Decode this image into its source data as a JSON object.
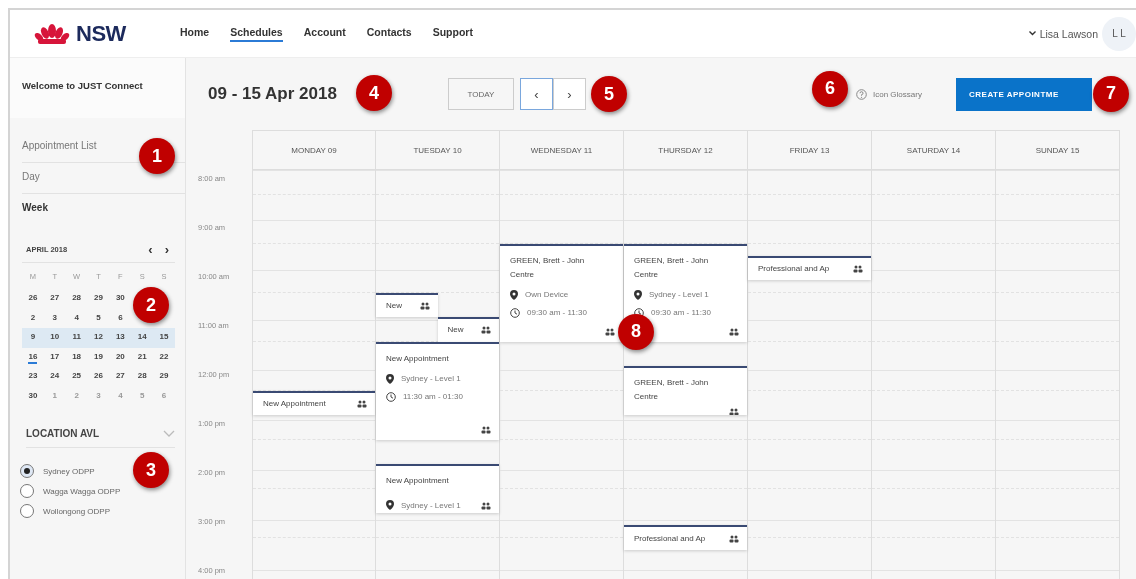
{
  "header": {
    "logo": "NSW",
    "nav": [
      {
        "label": "Home",
        "selected": false
      },
      {
        "label": "Schedules",
        "selected": true
      },
      {
        "label": "Account",
        "selected": false
      },
      {
        "label": "Contacts",
        "selected": false
      },
      {
        "label": "Support",
        "selected": false
      }
    ],
    "user": {
      "name": "Lisa Lawson",
      "initials": "L L"
    }
  },
  "sidebar": {
    "welcome": "Welcome to JUST Connect",
    "callout": "1",
    "views": [
      {
        "label": "Appointment List",
        "selected": false
      },
      {
        "label": "Day",
        "selected": false
      },
      {
        "label": "Week",
        "selected": true
      }
    ],
    "mini_calendar": {
      "month": "APRIL 2018",
      "prev": "‹",
      "next": "›",
      "callout": "2",
      "weekdays": [
        "M",
        "T",
        "W",
        "T",
        "F",
        "S",
        "S"
      ],
      "weeks": [
        {
          "selected": false,
          "days": [
            {
              "d": "26",
              "muted": false,
              "today": false
            },
            {
              "d": "27",
              "muted": false,
              "today": false
            },
            {
              "d": "28",
              "muted": false,
              "today": false
            },
            {
              "d": "29",
              "muted": false,
              "today": false
            },
            {
              "d": "30",
              "muted": false,
              "today": false
            }
          ]
        },
        {
          "selected": false,
          "days": [
            {
              "d": "2",
              "muted": false,
              "today": false
            },
            {
              "d": "3",
              "muted": false,
              "today": false
            },
            {
              "d": "4",
              "muted": false,
              "today": false
            },
            {
              "d": "5",
              "muted": false,
              "today": false
            },
            {
              "d": "6",
              "muted": false,
              "today": false
            }
          ]
        },
        {
          "selected": true,
          "days": [
            {
              "d": "9",
              "muted": false,
              "today": false
            },
            {
              "d": "10",
              "muted": false,
              "today": false
            },
            {
              "d": "11",
              "muted": false,
              "today": false
            },
            {
              "d": "12",
              "muted": false,
              "today": false
            },
            {
              "d": "13",
              "muted": false,
              "today": false
            },
            {
              "d": "14",
              "muted": false,
              "today": false
            },
            {
              "d": "15",
              "muted": false,
              "today": false
            }
          ]
        },
        {
          "selected": false,
          "days": [
            {
              "d": "16",
              "muted": false,
              "today": true
            },
            {
              "d": "17",
              "muted": false,
              "today": false
            },
            {
              "d": "18",
              "muted": false,
              "today": false
            },
            {
              "d": "19",
              "muted": false,
              "today": false
            },
            {
              "d": "20",
              "muted": false,
              "today": false
            },
            {
              "d": "21",
              "muted": false,
              "today": false
            },
            {
              "d": "22",
              "muted": false,
              "today": false
            }
          ]
        },
        {
          "selected": false,
          "days": [
            {
              "d": "23",
              "muted": false,
              "today": false
            },
            {
              "d": "24",
              "muted": false,
              "today": false
            },
            {
              "d": "25",
              "muted": false,
              "today": false
            },
            {
              "d": "26",
              "muted": false,
              "today": false
            },
            {
              "d": "27",
              "muted": false,
              "today": false
            },
            {
              "d": "28",
              "muted": false,
              "today": false
            },
            {
              "d": "29",
              "muted": false,
              "today": false
            }
          ]
        },
        {
          "selected": false,
          "days": [
            {
              "d": "30",
              "muted": false,
              "today": false
            },
            {
              "d": "1",
              "muted": true,
              "today": false
            },
            {
              "d": "2",
              "muted": true,
              "today": false
            },
            {
              "d": "3",
              "muted": true,
              "today": false
            },
            {
              "d": "4",
              "muted": true,
              "today": false
            },
            {
              "d": "5",
              "muted": true,
              "today": false
            },
            {
              "d": "6",
              "muted": true,
              "today": false
            }
          ]
        }
      ]
    },
    "location": {
      "title": "LOCATION AVL",
      "callout": "3",
      "options": [
        {
          "label": "Sydney ODPP",
          "selected": true
        },
        {
          "label": "Wagga Wagga ODPP",
          "selected": false
        },
        {
          "label": "Wollongong ODPP",
          "selected": false
        }
      ]
    }
  },
  "toolbar": {
    "title": "09 - 15 Apr 2018",
    "title_callout": "4",
    "today": "TODAY",
    "prev": "‹",
    "next": "›",
    "nav_callout": "5",
    "glossary": "Icon Glossary",
    "glossary_callout": "6",
    "create": "CREATE APPOINTME",
    "create_callout": "7"
  },
  "calendar": {
    "hours": [
      "8:00 am",
      "9:00 am",
      "10:00 am",
      "11:00 am",
      "12:00 pm",
      "1:00 pm",
      "2:00 pm",
      "3:00 pm",
      "4:00 pm"
    ],
    "columns": [
      {
        "label": "MONDAY 09",
        "events": [
          {
            "kind": "compact",
            "title": "New Appointment"
          }
        ]
      },
      {
        "label": "TUESDAY 10",
        "events": [
          {
            "kind": "compact",
            "title": "New"
          },
          {
            "kind": "compact",
            "title": "New"
          },
          {
            "kind": "detail",
            "title": "New Appointment",
            "location": "Sydney - Level 1",
            "time": "11:30 am - 01:30"
          },
          {
            "kind": "detail",
            "title": "New Appointment",
            "location": "Sydney - Level 1"
          }
        ]
      },
      {
        "label": "WEDNESDAY 11",
        "events": [
          {
            "kind": "detail",
            "title": "GREEN, Brett - John Centre",
            "location": "Own Device",
            "time": "09:30 am - 11:30"
          }
        ]
      },
      {
        "label": "THURSDAY 12",
        "events": [
          {
            "kind": "detail",
            "title": "GREEN, Brett - John Centre",
            "location": "Sydney - Level 1",
            "time": "09:30 am - 11:30",
            "callout": "8"
          },
          {
            "kind": "detail",
            "title": "GREEN, Brett - John Centre"
          },
          {
            "kind": "compact",
            "title": "Professional and Ap"
          }
        ]
      },
      {
        "label": "FRIDAY 13",
        "events": [
          {
            "kind": "compact",
            "title": "Professional and Ap"
          }
        ]
      },
      {
        "label": "SATURDAY 14"
      },
      {
        "label": "SUNDAY 15"
      }
    ]
  }
}
